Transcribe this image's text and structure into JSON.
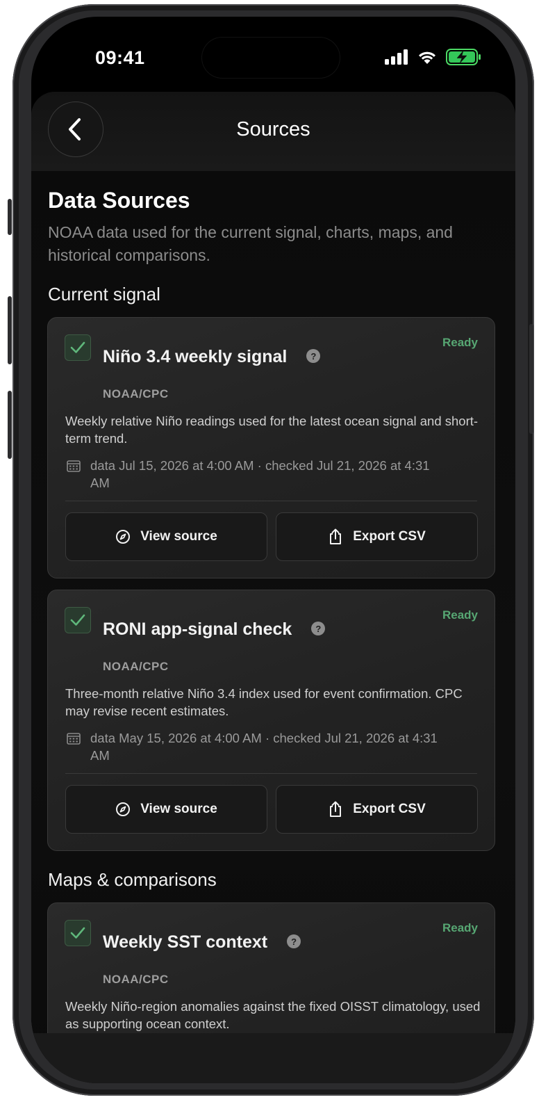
{
  "status_bar": {
    "time": "09:41"
  },
  "nav": {
    "title": "Sources"
  },
  "header": {
    "title": "Data Sources",
    "subtitle": "NOAA data used for the current signal, charts, maps, and historical comparisons."
  },
  "sections": {
    "current_signal": "Current signal",
    "maps": "Maps & comparisons"
  },
  "cards": [
    {
      "title": "Niño 3.4 weekly signal",
      "status": "Ready",
      "org": "NOAA/CPC",
      "description": "Weekly relative Niño readings used for the latest ocean signal and short-term trend.",
      "meta": "data Jul 15, 2026 at 4:00 AM · checked Jul 21, 2026 at 4:31 AM",
      "view_label": "View source",
      "export_label": "Export CSV"
    },
    {
      "title": "RONI app-signal check",
      "status": "Ready",
      "org": "NOAA/CPC",
      "description": "Three-month relative Niño 3.4 index used for event confirmation. CPC may revise recent estimates.",
      "meta": "data May 15, 2026 at 4:00 AM · checked Jul 21, 2026 at 4:31 AM",
      "view_label": "View source",
      "export_label": "Export CSV"
    },
    {
      "title": "Weekly SST context",
      "status": "Ready",
      "org": "NOAA/CPC",
      "description": "Weekly Niño-region anomalies against the fixed OISST climatology, used as supporting ocean context."
    }
  ],
  "colors": {
    "ready": "#57a773",
    "background": "#0a0a0a",
    "card": "#262626"
  },
  "icons": [
    "back-chevron-icon",
    "checkmark-icon",
    "help-icon",
    "calendar-icon",
    "compass-icon",
    "share-icon"
  ]
}
